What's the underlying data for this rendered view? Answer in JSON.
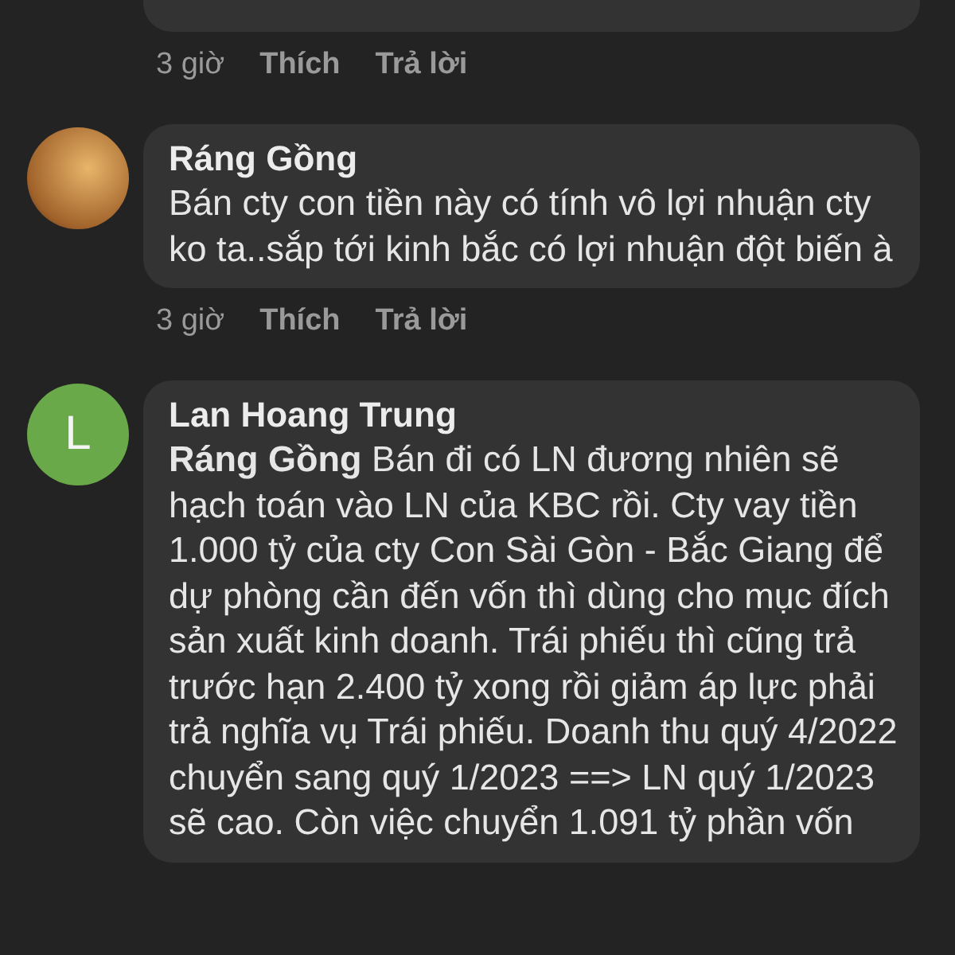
{
  "comments": [
    {
      "kind": "cut",
      "time": "3 giờ",
      "like": "Thích",
      "reply": "Trả lời"
    },
    {
      "kind": "photo",
      "author": "Ráng Gồng",
      "text": "Bán cty con tiền này có tính vô lợi nhuận cty ko ta..sắp tới kinh bắc có lợi nhuận đột biến à",
      "time": "3 giờ",
      "like": "Thích",
      "reply": "Trả lời"
    },
    {
      "kind": "letter",
      "avatar_letter": "L",
      "color": "#6aa94a",
      "author": "Lan Hoang Trung",
      "text": "**Ráng Gồng**  Bán đi có LN đương nhiên sẽ hạch toán vào LN của KBC rồi. Cty vay tiền 1.000 tỷ của cty Con Sài Gòn - Bắc Giang để dự phòng cần đến vốn thì dùng cho mục đích sản xuất kinh doanh. Trái phiếu thì cũng trả trước hạn 2.400 tỷ xong rồi giảm áp lực phải trả nghĩa vụ Trái phiếu. Doanh thu quý 4/2022 chuyển sang quý 1/2023 ==> LN quý 1/2023 sẽ cao. Còn việc chuyển 1.091 tỷ phần vốn"
    }
  ]
}
